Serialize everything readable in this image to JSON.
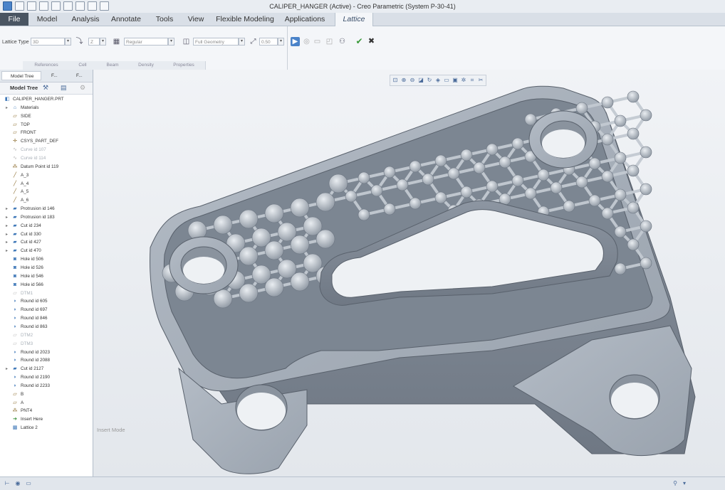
{
  "window": {
    "title": "CALIPER_HANGER (Active) - Creo Parametric (System P-30-41)"
  },
  "menu": {
    "tabs": [
      "File",
      "Model",
      "Analysis",
      "Annotate",
      "Tools",
      "View",
      "Flexible Modeling",
      "Applications",
      "Lattice"
    ]
  },
  "ribbon": {
    "lattice_type_label": "Lattice Type",
    "lattice_type_value": "3D",
    "axis_value": "Z",
    "cell_value": "Regular",
    "geometry_value": "Full Geometry",
    "scale_value": "0.50",
    "groups": [
      "References",
      "Cell",
      "Beam",
      "Density",
      "Properties"
    ]
  },
  "panel": {
    "tab1": "F...",
    "tab2": "F...",
    "model_tree_tab": "Model Tree",
    "model_tree_header": "Model Tree",
    "items": [
      {
        "label": "CALIPER_HANGER.PRT",
        "icon": "part-icon",
        "expand": false,
        "dim": false,
        "indent": 0
      },
      {
        "label": "Materials",
        "icon": "materials-icon",
        "expand": true,
        "dim": false,
        "indent": 1
      },
      {
        "label": "SIDE",
        "icon": "datum-plane-icon",
        "expand": false,
        "dim": false,
        "indent": 1
      },
      {
        "label": "TOP",
        "icon": "datum-plane-icon",
        "expand": false,
        "dim": false,
        "indent": 1
      },
      {
        "label": "FRONT",
        "icon": "datum-plane-icon",
        "expand": false,
        "dim": false,
        "indent": 1
      },
      {
        "label": "CSYS_PART_DEF",
        "icon": "csys-icon",
        "expand": false,
        "dim": false,
        "indent": 1
      },
      {
        "label": "Curve id 107",
        "icon": "curve-icon",
        "expand": false,
        "dim": true,
        "indent": 1
      },
      {
        "label": "Curve id 114",
        "icon": "curve-icon",
        "expand": false,
        "dim": true,
        "indent": 1
      },
      {
        "label": "Datum Point id 119",
        "icon": "datum-point-icon",
        "expand": false,
        "dim": false,
        "indent": 1
      },
      {
        "label": "A_3",
        "icon": "axis-icon",
        "expand": false,
        "dim": false,
        "indent": 1
      },
      {
        "label": "A_4",
        "icon": "axis-icon",
        "expand": false,
        "dim": false,
        "indent": 1
      },
      {
        "label": "A_5",
        "icon": "axis-icon",
        "expand": false,
        "dim": false,
        "indent": 1
      },
      {
        "label": "A_6",
        "icon": "axis-icon",
        "expand": false,
        "dim": false,
        "indent": 1
      },
      {
        "label": "Protrusion id 146",
        "icon": "protrusion-icon",
        "expand": true,
        "dim": false,
        "indent": 1
      },
      {
        "label": "Protrusion id 183",
        "icon": "protrusion-icon",
        "expand": true,
        "dim": false,
        "indent": 1
      },
      {
        "label": "Cut id 234",
        "icon": "cut-icon",
        "expand": true,
        "dim": false,
        "indent": 1
      },
      {
        "label": "Cut id 330",
        "icon": "cut-icon",
        "expand": true,
        "dim": false,
        "indent": 1
      },
      {
        "label": "Cut id 427",
        "icon": "cut-icon",
        "expand": true,
        "dim": false,
        "indent": 1
      },
      {
        "label": "Cut id 470",
        "icon": "cut-icon",
        "expand": true,
        "dim": false,
        "indent": 1
      },
      {
        "label": "Hole id 506",
        "icon": "hole-icon",
        "expand": false,
        "dim": false,
        "indent": 1
      },
      {
        "label": "Hole id 526",
        "icon": "hole-icon",
        "expand": false,
        "dim": false,
        "indent": 1
      },
      {
        "label": "Hole id 546",
        "icon": "hole-icon",
        "expand": false,
        "dim": false,
        "indent": 1
      },
      {
        "label": "Hole id 566",
        "icon": "hole-icon",
        "expand": false,
        "dim": false,
        "indent": 1
      },
      {
        "label": "DTM1",
        "icon": "datum-plane-icon",
        "expand": false,
        "dim": true,
        "indent": 1
      },
      {
        "label": "Round id 605",
        "icon": "round-icon",
        "expand": false,
        "dim": false,
        "indent": 1
      },
      {
        "label": "Round id 697",
        "icon": "round-icon",
        "expand": false,
        "dim": false,
        "indent": 1
      },
      {
        "label": "Round id 846",
        "icon": "round-icon",
        "expand": false,
        "dim": false,
        "indent": 1
      },
      {
        "label": "Round id 863",
        "icon": "round-icon",
        "expand": false,
        "dim": false,
        "indent": 1
      },
      {
        "label": "DTM2",
        "icon": "datum-plane-icon",
        "expand": false,
        "dim": true,
        "indent": 1
      },
      {
        "label": "DTM3",
        "icon": "datum-plane-icon",
        "expand": false,
        "dim": true,
        "indent": 1
      },
      {
        "label": "Round id 2023",
        "icon": "round-icon",
        "expand": false,
        "dim": false,
        "indent": 1
      },
      {
        "label": "Round id 2088",
        "icon": "round-icon",
        "expand": false,
        "dim": false,
        "indent": 1
      },
      {
        "label": "Cut id 2127",
        "icon": "cut-icon",
        "expand": true,
        "dim": false,
        "indent": 1
      },
      {
        "label": "Round id 2190",
        "icon": "round-icon",
        "expand": false,
        "dim": false,
        "indent": 1
      },
      {
        "label": "Round id 2233",
        "icon": "round-icon",
        "expand": false,
        "dim": false,
        "indent": 1
      },
      {
        "label": "B",
        "icon": "datum-plane-icon",
        "expand": false,
        "dim": false,
        "indent": 1
      },
      {
        "label": "A",
        "icon": "datum-plane-icon",
        "expand": false,
        "dim": false,
        "indent": 1
      },
      {
        "label": "PNT4",
        "icon": "datum-point-icon",
        "expand": false,
        "dim": false,
        "indent": 1
      },
      {
        "label": "Insert Here",
        "icon": "insert-here-icon",
        "expand": false,
        "dim": false,
        "indent": 1
      },
      {
        "label": "Lattice 2",
        "icon": "lattice-icon",
        "expand": false,
        "dim": false,
        "indent": 1
      }
    ]
  },
  "viewport": {
    "mode_text": "Insert Mode"
  },
  "colors": {
    "accent": "#4a83c9",
    "part": "#a9b2bd",
    "background": "#e8ecf0"
  }
}
